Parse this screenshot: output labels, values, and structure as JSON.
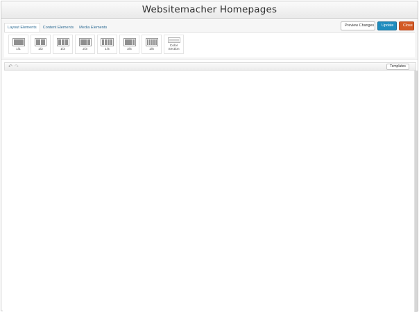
{
  "window": {
    "title": "Websitemacher Homepages"
  },
  "tabs": [
    {
      "label": "Layout Elements",
      "active": true
    },
    {
      "label": "Content Elements",
      "active": false
    },
    {
      "label": "Media Elements",
      "active": false
    }
  ],
  "layout_elements": [
    {
      "label": "1/1",
      "icon": "column-1-1-icon"
    },
    {
      "label": "1/2",
      "icon": "column-1-2-icon"
    },
    {
      "label": "1/3",
      "icon": "column-1-3-icon"
    },
    {
      "label": "2/3",
      "icon": "column-2-3-icon"
    },
    {
      "label": "1/4",
      "icon": "column-1-4-icon"
    },
    {
      "label": "3/4",
      "icon": "column-3-4-icon"
    },
    {
      "label": "1/5",
      "icon": "column-1-5-icon"
    },
    {
      "label": "Color Section",
      "icon": "color-section-icon"
    }
  ],
  "actions": {
    "preview_label": "Preview Changes",
    "update_label": "Update",
    "close_label": "Close"
  },
  "editor_bar": {
    "undo_icon": "undo-icon",
    "redo_icon": "redo-icon",
    "templates_label": "Templates"
  },
  "colors": {
    "update_button": "#1e8cbe",
    "close_button": "#d35a25",
    "tab_link": "#2b6a93"
  }
}
